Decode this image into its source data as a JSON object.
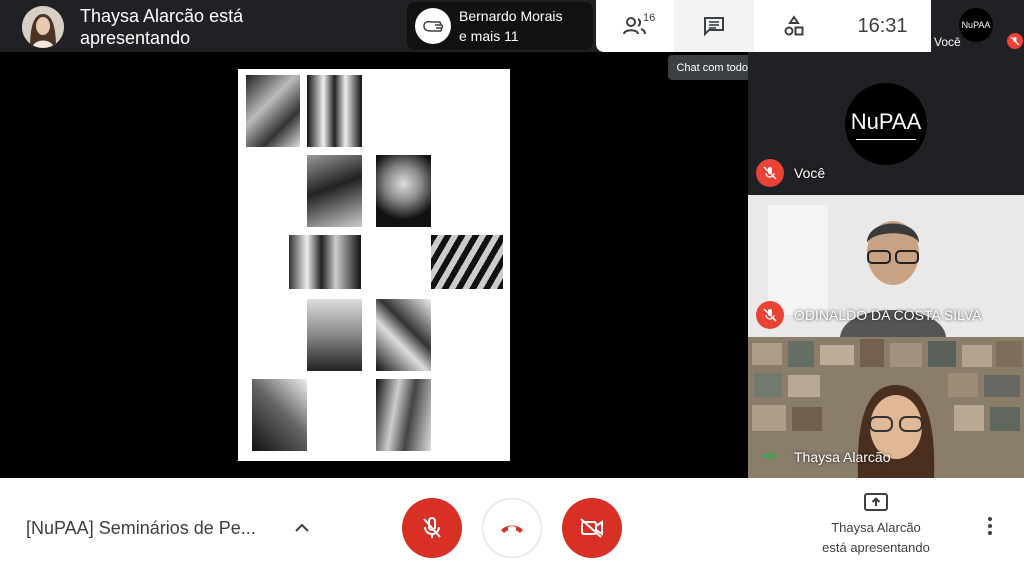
{
  "topbar": {
    "presenter_text": "Thaysa Alarcão está apresentando",
    "others_line1": "Bernardo Morais",
    "others_line2": "e mais 11",
    "people_count": "16",
    "clock": "16:31",
    "self_label": "Você",
    "self_logo": "NuPAA",
    "chat_tooltip": "Chat com todos"
  },
  "tiles": [
    {
      "name": "Você",
      "logo": "NuPAA",
      "muted": true
    },
    {
      "name": "ODINALDO DA COSTA SILVA",
      "muted": true
    },
    {
      "name": "Thaysa Alarcão",
      "muted": false,
      "speaking": true
    }
  ],
  "bottombar": {
    "meeting_title": "[NuPAA] Seminários de Pe...",
    "presenting_line1": "Thaysa Alarcão",
    "presenting_line2": "está apresentando"
  },
  "colors": {
    "danger": "#d93025",
    "dark": "#202124",
    "text": "#3c4043"
  },
  "icons": [
    "people-icon",
    "chat-icon",
    "activities-icon",
    "hand-icon",
    "mic-off-icon",
    "hangup-icon",
    "camera-off-icon",
    "present-icon",
    "more-icon",
    "chevron-up-icon"
  ]
}
